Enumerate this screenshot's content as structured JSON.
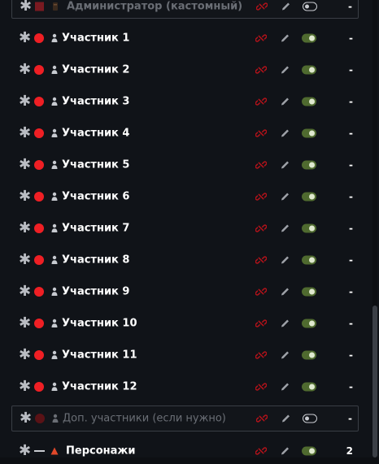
{
  "admin_row": {
    "label": "Администратор (кастомный)",
    "count": "-"
  },
  "participants": [
    {
      "label": "Участник 1",
      "count": "-"
    },
    {
      "label": "Участник 2",
      "count": "-"
    },
    {
      "label": "Участник 3",
      "count": "-"
    },
    {
      "label": "Участник 4",
      "count": "-"
    },
    {
      "label": "Участник 5",
      "count": "-"
    },
    {
      "label": "Участник 6",
      "count": "-"
    },
    {
      "label": "Участник 7",
      "count": "-"
    },
    {
      "label": "Участник 8",
      "count": "-"
    },
    {
      "label": "Участник 9",
      "count": "-"
    },
    {
      "label": "Участник 10",
      "count": "-"
    },
    {
      "label": "Участник 11",
      "count": "-"
    },
    {
      "label": "Участник 12",
      "count": "-"
    }
  ],
  "extra_row": {
    "label": "Доп. участники (если нужно)",
    "count": "-"
  },
  "characters_row": {
    "label": "Персонажи",
    "count": "2"
  },
  "icons": {
    "drag": "asterisk-drag-handle-icon",
    "role_user": "person-icon",
    "role_admin": "square-role-icon",
    "role_characters": "triangle-icon",
    "unlink": "unlink-icon",
    "edit": "pencil-icon",
    "toggle": "toggle-icon"
  },
  "colors": {
    "background": "#101318",
    "active_dot": "#ef1f24",
    "inactive_dot": "#5a1216",
    "unlink_red": "#b3121a",
    "toggle_on": "#4f6a2f",
    "text": "#ffffff",
    "muted_text": "#6a6e75"
  }
}
